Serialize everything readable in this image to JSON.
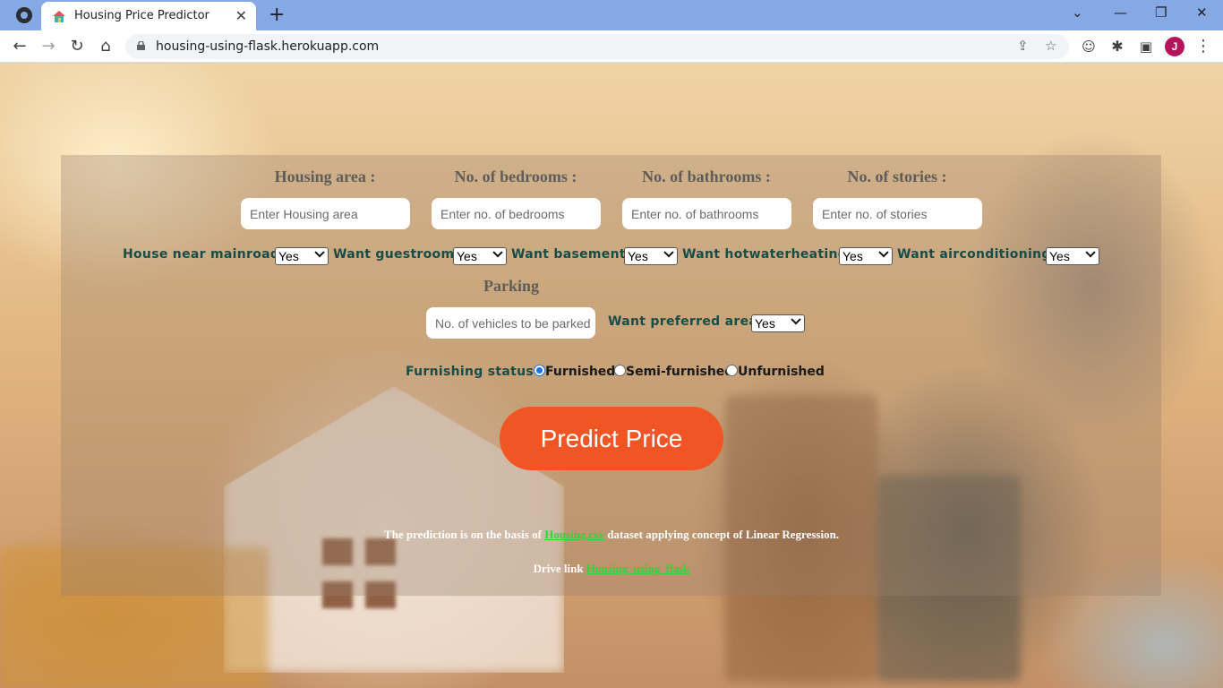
{
  "browser": {
    "tab_title": "Housing Price Predictor",
    "url": "housing-using-flask.herokuapp.com",
    "profile_initial": "J"
  },
  "form": {
    "fields": [
      {
        "label": "Housing area :",
        "placeholder": "Enter Housing area"
      },
      {
        "label": "No. of bedrooms :",
        "placeholder": "Enter no. of bedrooms"
      },
      {
        "label": "No. of bathrooms :",
        "placeholder": "Enter no. of bathrooms"
      },
      {
        "label": "No. of stories :",
        "placeholder": "Enter no. of stories"
      }
    ],
    "questions": [
      {
        "label": "House near mainroad ?",
        "value": "Yes"
      },
      {
        "label": "Want guestroom ?",
        "value": "Yes"
      },
      {
        "label": "Want basement ?",
        "value": "Yes"
      },
      {
        "label": "Want hotwaterheating ?",
        "value": "Yes"
      },
      {
        "label": "Want airconditioning ?",
        "value": "Yes"
      }
    ],
    "parking": {
      "label": "Parking",
      "placeholder": "No. of vehicles to be parked"
    },
    "preferred_area": {
      "label": "Want preferred area ?",
      "value": "Yes"
    },
    "furnishing": {
      "label": "Furnishing status ?",
      "options": [
        "Furnished",
        "Semi-furnished",
        "Unfurnished"
      ],
      "selected": "Furnished"
    },
    "submit_label": "Predict Price"
  },
  "footer": {
    "note_prefix": "The prediction is on the basis of ",
    "dataset_link": "Housing.csv",
    "note_suffix": " dataset applying concept of Linear Regression.",
    "drive_prefix": "Drive link ",
    "drive_link": "Housing_using_flask"
  },
  "colors": {
    "accent_button": "#f15524",
    "question_text": "#174d46",
    "link": "#30d43a"
  }
}
